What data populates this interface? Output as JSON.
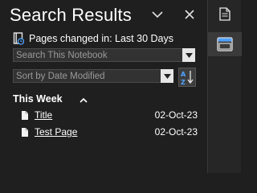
{
  "header": {
    "title": "Search Results",
    "collapse_icon": "chevron-down-icon",
    "close_icon": "close-icon"
  },
  "scope": {
    "label": "Pages changed in: Last 30 Days",
    "icon": "notebook-clock-icon"
  },
  "search_field": {
    "value": "Search This Notebook",
    "dropdown_icon": "dropdown-arrow-icon"
  },
  "sort_field": {
    "value": "Sort by Date Modified",
    "dropdown_icon": "dropdown-arrow-icon",
    "sort_order_icon": "sort-a-z-icon"
  },
  "groups": [
    {
      "label": "This Week",
      "expanded": true,
      "items": [
        {
          "name": "Title",
          "date": "02-Oct-23"
        },
        {
          "name": "Test Page",
          "date": "02-Oct-23"
        }
      ]
    }
  ],
  "rail": {
    "icons": [
      "page-icon",
      "panel-icon"
    ],
    "active": "panel-icon"
  },
  "colors": {
    "background": "#1f1f1f",
    "field_bg": "#323232",
    "accent_blue": "#4fa3ff"
  }
}
